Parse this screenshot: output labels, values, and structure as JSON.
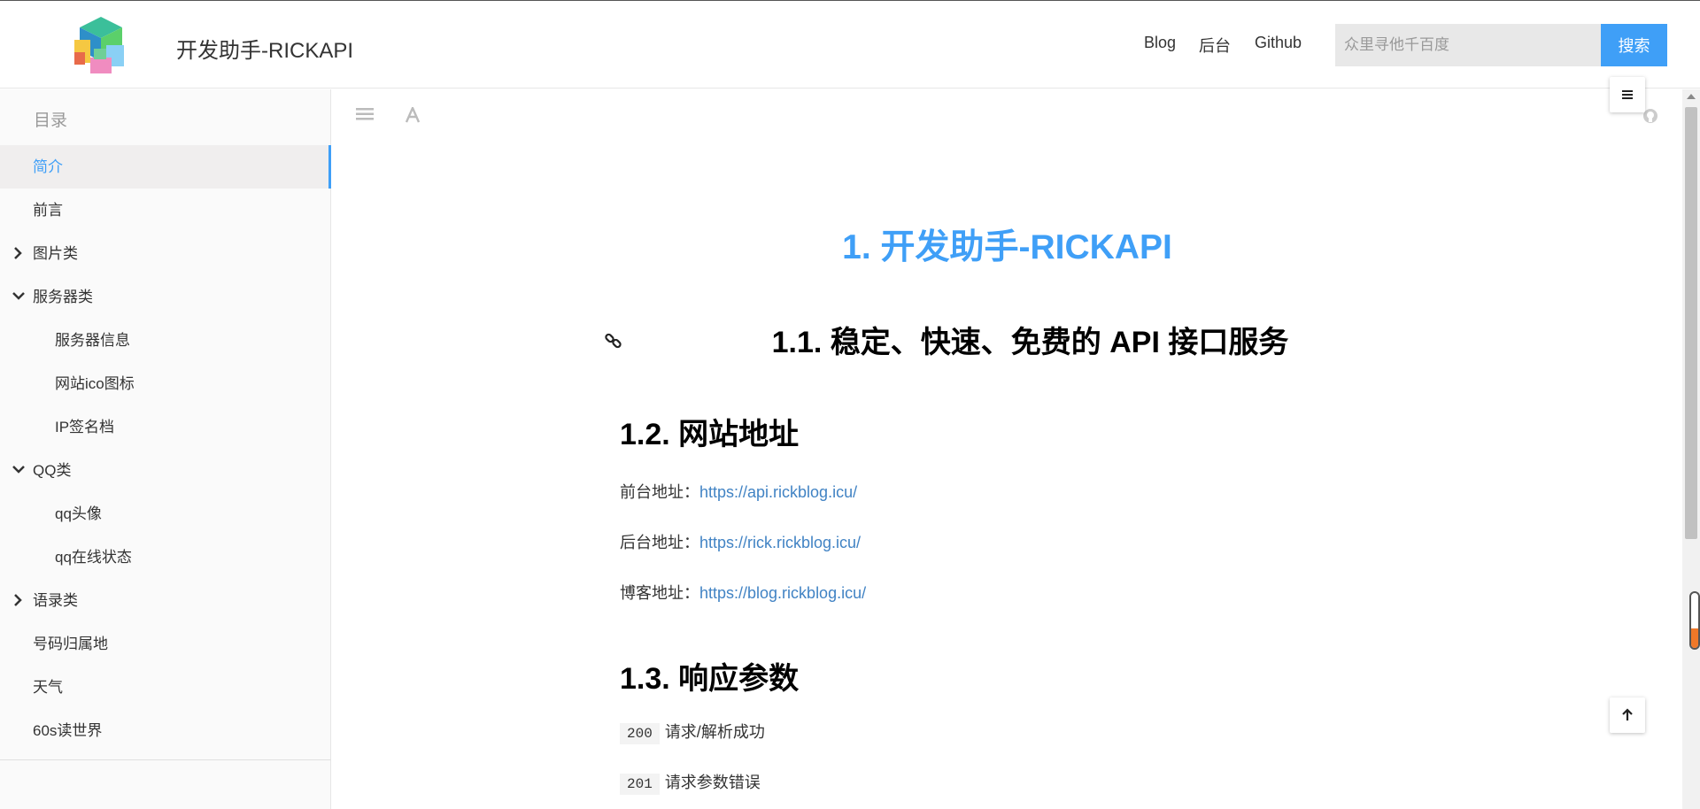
{
  "header": {
    "site_title": "开发助手-RICKAPI",
    "nav": [
      {
        "label": "Blog"
      },
      {
        "label": "后台"
      },
      {
        "label": "Github"
      }
    ],
    "search": {
      "placeholder": "众里寻他千百度",
      "button_label": "搜索"
    }
  },
  "sidebar": {
    "title": "目录",
    "items": [
      {
        "label": "简介",
        "active": true
      },
      {
        "label": "前言"
      },
      {
        "label": "图片类",
        "chevron": "right"
      },
      {
        "label": "服务器类",
        "chevron": "down"
      },
      {
        "label": "服务器信息",
        "sub": true
      },
      {
        "label": "网站ico图标",
        "sub": true
      },
      {
        "label": "IP签名档",
        "sub": true
      },
      {
        "label": "QQ类",
        "chevron": "down"
      },
      {
        "label": "qq头像",
        "sub": true
      },
      {
        "label": "qq在线状态",
        "sub": true
      },
      {
        "label": "语录类",
        "chevron": "right"
      },
      {
        "label": "号码归属地"
      },
      {
        "label": "天气"
      },
      {
        "label": "60s读世界"
      }
    ]
  },
  "content": {
    "h1": "1. 开发助手-RICKAPI",
    "h2_service": "1.1. 稳定、快速、免费的 API 接口服务",
    "h2_address": "1.2. 网站地址",
    "addresses": [
      {
        "label": "前台地址：",
        "url": "https://api.rickblog.icu/"
      },
      {
        "label": "后台地址：",
        "url": "https://rick.rickblog.icu/"
      },
      {
        "label": "博客地址：",
        "url": "https://blog.rickblog.icu/"
      }
    ],
    "h2_response": "1.3. 响应参数",
    "codes": [
      {
        "code": "200",
        "desc": "请求/解析成功"
      },
      {
        "code": "201",
        "desc": "请求参数错误"
      }
    ]
  },
  "colors": {
    "accent": "#3f9ff7",
    "link": "#4183c4",
    "active_bg": "#f0eeee"
  },
  "icons": {
    "toolbar": [
      "menu-lines-icon",
      "font-icon",
      "github-icon"
    ],
    "heading_anchor": "link-icon",
    "float": [
      "hamburger-icon",
      "arrow-up-icon"
    ]
  },
  "volume_level": 0.35
}
